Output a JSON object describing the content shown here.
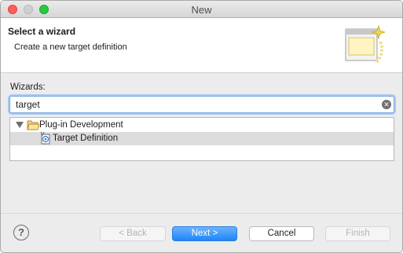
{
  "window": {
    "title": "New"
  },
  "header": {
    "title": "Select a wizard",
    "description": "Create a new target definition",
    "icon": "wizard-banner-icon"
  },
  "wizards": {
    "label": "Wizards:",
    "search_value": "target",
    "clear_icon": "clear-search-icon"
  },
  "tree": {
    "items": [
      {
        "label": "Plug-in Development",
        "icon": "folder-icon",
        "expanded": true
      },
      {
        "label": "Target Definition",
        "icon": "target-definition-icon",
        "selected": true
      }
    ]
  },
  "buttons": {
    "help": "?",
    "back": "< Back",
    "next": "Next >",
    "cancel": "Cancel",
    "finish": "Finish"
  },
  "colors": {
    "accent": "#1e85fb",
    "selection": "#dcdcdc"
  }
}
